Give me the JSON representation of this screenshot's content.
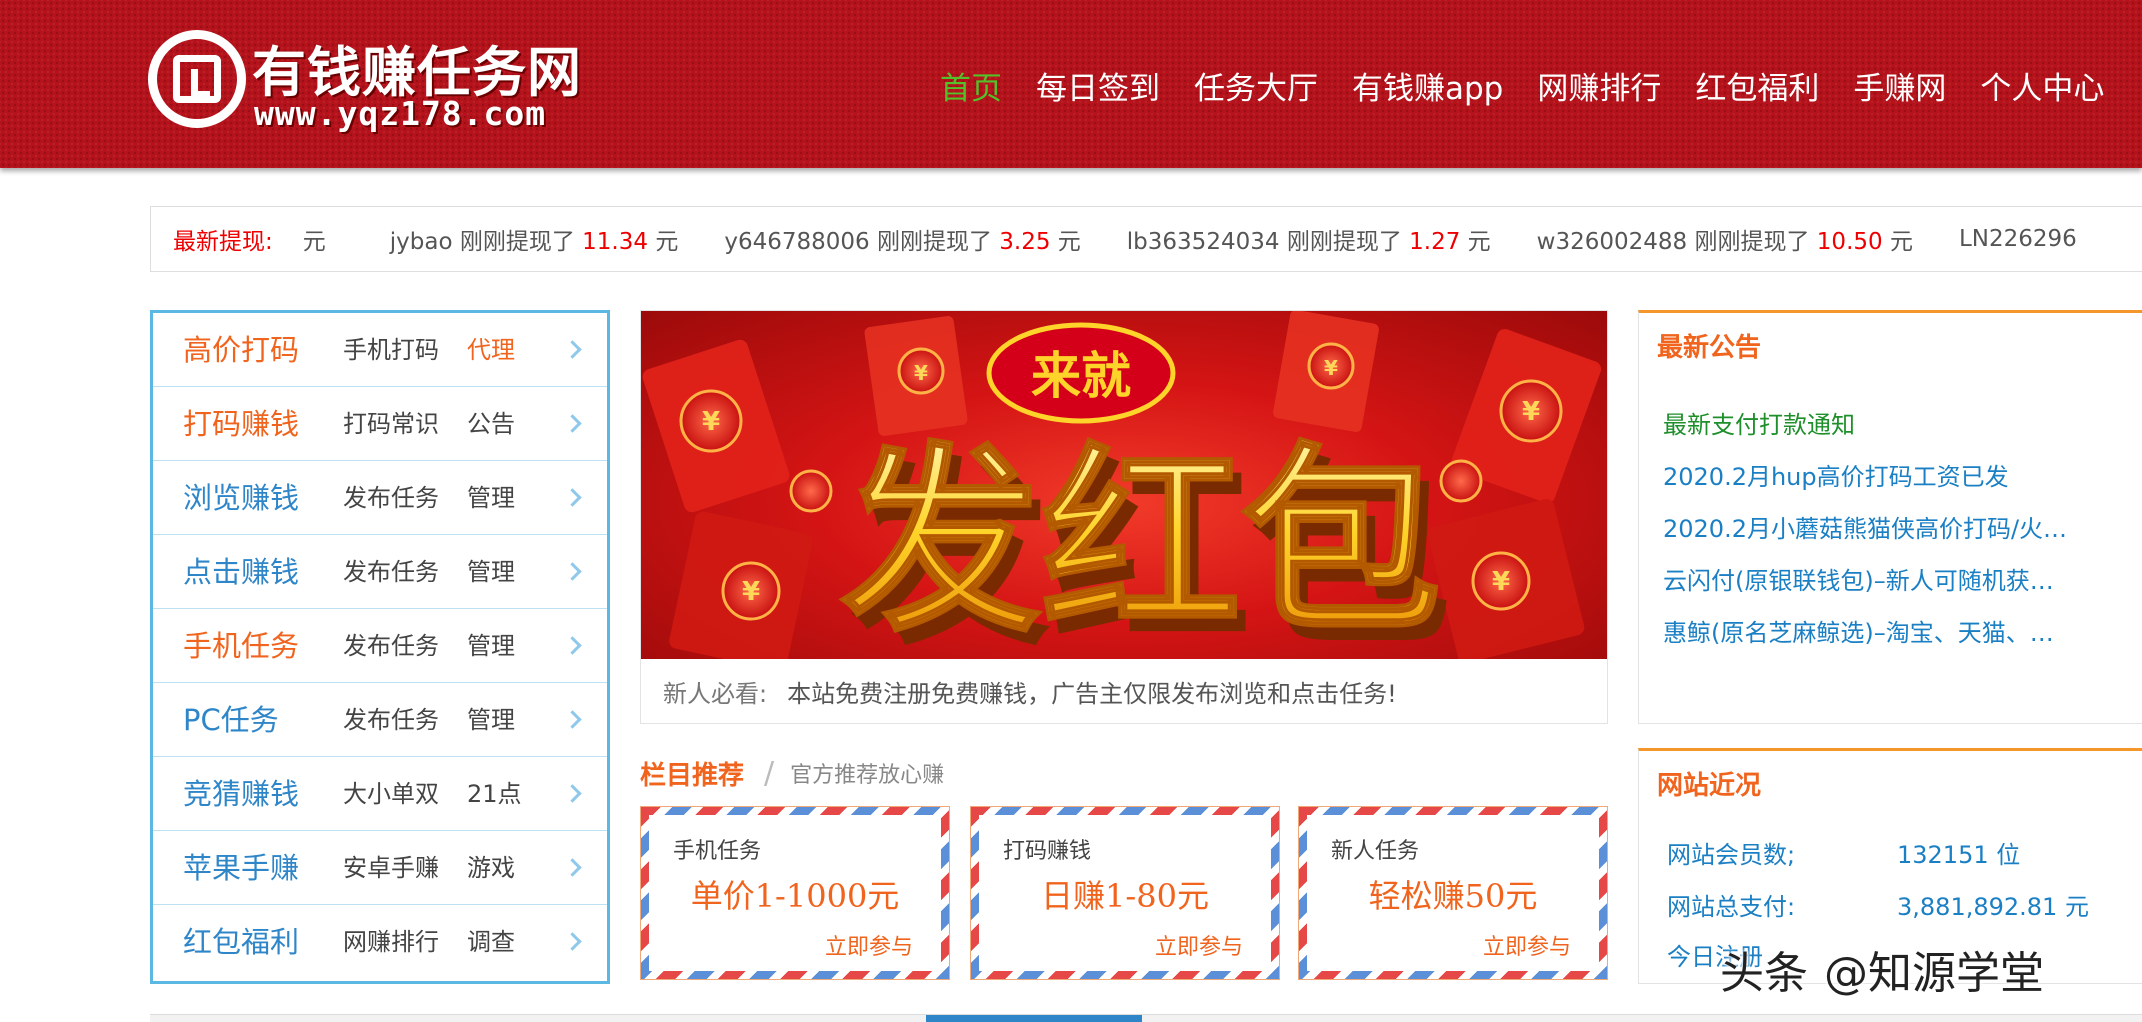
{
  "header": {
    "logo_title": "有钱赚任务网",
    "logo_url": "www.yqz178.com",
    "nav": [
      {
        "label": "首页",
        "active": true
      },
      {
        "label": "每日签到"
      },
      {
        "label": "任务大厅"
      },
      {
        "label": "有钱赚app"
      },
      {
        "label": "网赚排行"
      },
      {
        "label": "红包福利"
      },
      {
        "label": "手赚网"
      },
      {
        "label": "个人中心"
      }
    ],
    "active_color": "#52c22a",
    "bg_color": "#b5121b"
  },
  "ticker": {
    "label": "最新提现:",
    "pre": "元",
    "items": [
      {
        "user": "jybao",
        "action": "刚刚提现了",
        "amount": "11.34",
        "unit": "元"
      },
      {
        "user": "y646788006",
        "action": "刚刚提现了",
        "amount": "3.25",
        "unit": "元"
      },
      {
        "user": "lb363524034",
        "action": "刚刚提现了",
        "amount": "1.27",
        "unit": "元"
      },
      {
        "user": "w326002488",
        "action": "刚刚提现了",
        "amount": "10.50",
        "unit": "元"
      },
      {
        "user": "LN226296",
        "action": "",
        "amount": "",
        "unit": ""
      }
    ]
  },
  "side_menu": [
    {
      "cat": "高价打码",
      "color": "orange",
      "sub1": "手机打码",
      "sub2": "代理",
      "sub2_color": "orange"
    },
    {
      "cat": "打码赚钱",
      "color": "orange",
      "sub1": "打码常识",
      "sub2": "公告"
    },
    {
      "cat": "浏览赚钱",
      "color": "blue",
      "sub1": "发布任务",
      "sub2": "管理"
    },
    {
      "cat": "点击赚钱",
      "color": "blue",
      "sub1": "发布任务",
      "sub2": "管理"
    },
    {
      "cat": "手机任务",
      "color": "orange",
      "sub1": "发布任务",
      "sub2": "管理"
    },
    {
      "cat": "PC任务",
      "color": "blue",
      "sub1": "发布任务",
      "sub2": "管理"
    },
    {
      "cat": "竞猜赚钱",
      "color": "blue",
      "sub1": "大小单双",
      "sub2": "21点"
    },
    {
      "cat": "苹果手赚",
      "color": "blue",
      "sub1": "安卓手赚",
      "sub2": "游戏"
    },
    {
      "cat": "红包福利",
      "color": "blue",
      "sub1": "网赚排行",
      "sub2": "调查"
    }
  ],
  "banner": {
    "top_text": "来就",
    "main_text": "发红包",
    "caption_label": "新人必看:",
    "caption_text": "本站免费注册免费赚钱，广告主仅限发布浏览和点击任务!"
  },
  "recommend": {
    "title": "栏目推荐",
    "separator": "/",
    "subtitle": "官方推荐放心赚",
    "cards": [
      {
        "label": "手机任务",
        "value": "单价1-1000元",
        "cta": "立即参与"
      },
      {
        "label": "打码赚钱",
        "value": "日赚1-80元",
        "cta": "立即参与"
      },
      {
        "label": "新人任务",
        "value": "轻松赚50元",
        "cta": "立即参与"
      }
    ]
  },
  "notices": {
    "title": "最新公告",
    "items": [
      {
        "text": "最新支付打款通知",
        "color": "green"
      },
      {
        "text": "2020.2月hup高价打码工资已发",
        "color": "blue"
      },
      {
        "text": "2020.2月小蘑菇熊猫侠高价打码/火…",
        "color": "blue"
      },
      {
        "text": "云闪付(原银联钱包)–新人可随机获…",
        "color": "blue"
      },
      {
        "text": "惠鲸(原名芝麻鲸选)–淘宝、天猫、…",
        "color": "blue"
      }
    ]
  },
  "stats": {
    "title": "网站近况",
    "items": [
      {
        "label": "网站会员数;",
        "value": "132151 位"
      },
      {
        "label": "网站总支付:",
        "value": "3,881,892.81 元"
      },
      {
        "label": "今日注册",
        "value": ""
      }
    ]
  },
  "watermark": {
    "brand": "头条",
    "account": "@知源学堂"
  }
}
